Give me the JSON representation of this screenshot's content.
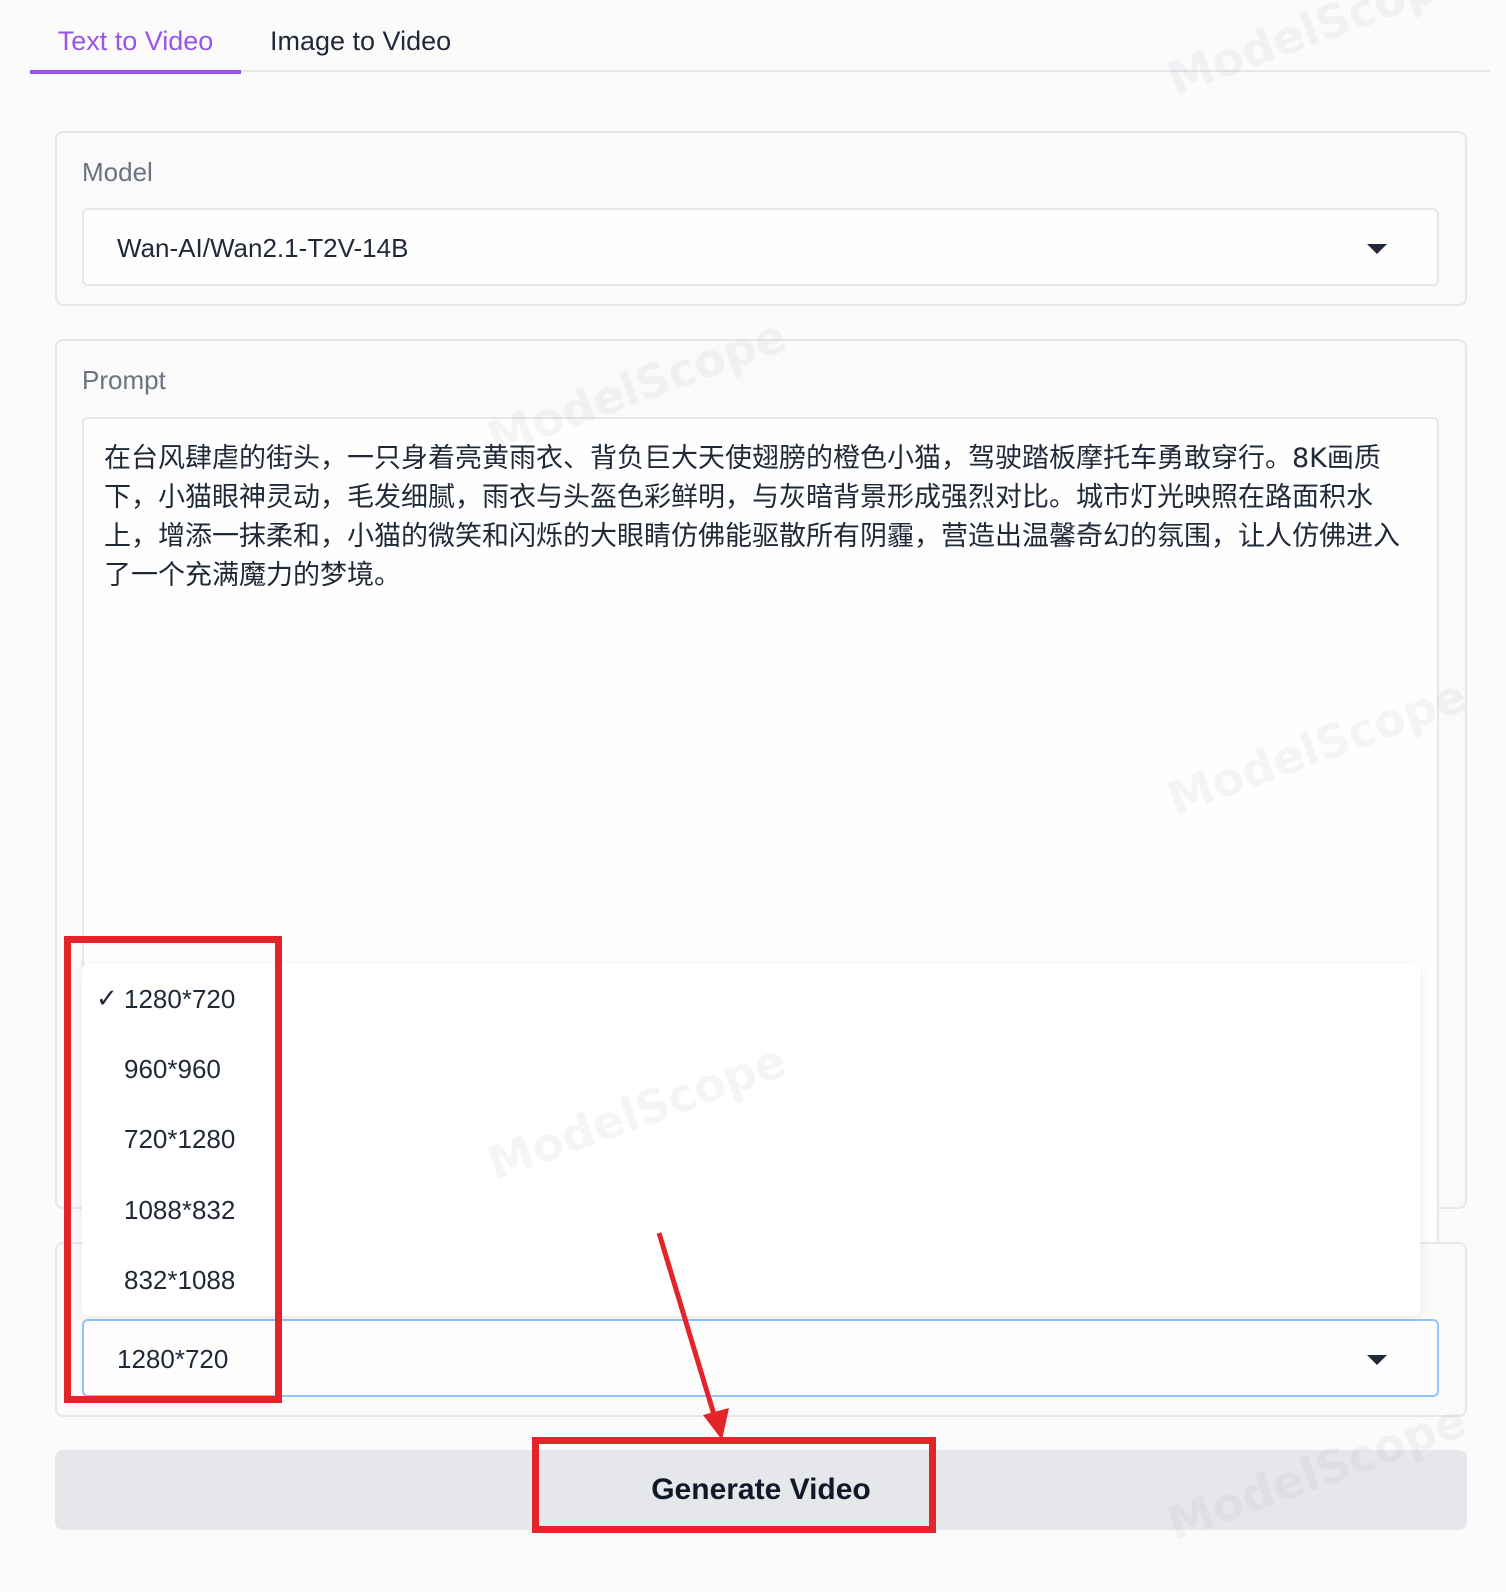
{
  "tabs": [
    {
      "label": "Text to Video",
      "active": true
    },
    {
      "label": "Image to Video",
      "active": false
    }
  ],
  "model": {
    "label": "Model",
    "value": "Wan-AI/Wan2.1-T2V-14B"
  },
  "prompt": {
    "label": "Prompt",
    "value": "在台风肆虐的街头，一只身着亮黄雨衣、背负巨大天使翅膀的橙色小猫，驾驶踏板摩托车勇敢穿行。8K画质下，小猫眼神灵动，毛发细腻，雨衣与头盔色彩鲜明，与灰暗背景形成强烈对比。城市灯光映照在路面积水上，增添一抹柔和，小猫的微笑和闪烁的大眼睛仿佛能驱散所有阴霾，营造出温馨奇幻的氛围，让人仿佛进入了一个充满魔力的梦境。"
  },
  "resolution": {
    "value": "1280*720",
    "options": [
      {
        "label": "1280*720",
        "selected": true
      },
      {
        "label": "960*960",
        "selected": false
      },
      {
        "label": "720*1280",
        "selected": false
      },
      {
        "label": "1088*832",
        "selected": false
      },
      {
        "label": "832*1088",
        "selected": false
      }
    ],
    "check_mark": "✓"
  },
  "generate_button": {
    "label": "Generate Video"
  },
  "watermark": "ModelScope",
  "colors": {
    "accent": "#9b55e6",
    "annotation": "#e3242b",
    "focus_border": "#93c5fd",
    "button_bg": "#e5e7eb"
  }
}
